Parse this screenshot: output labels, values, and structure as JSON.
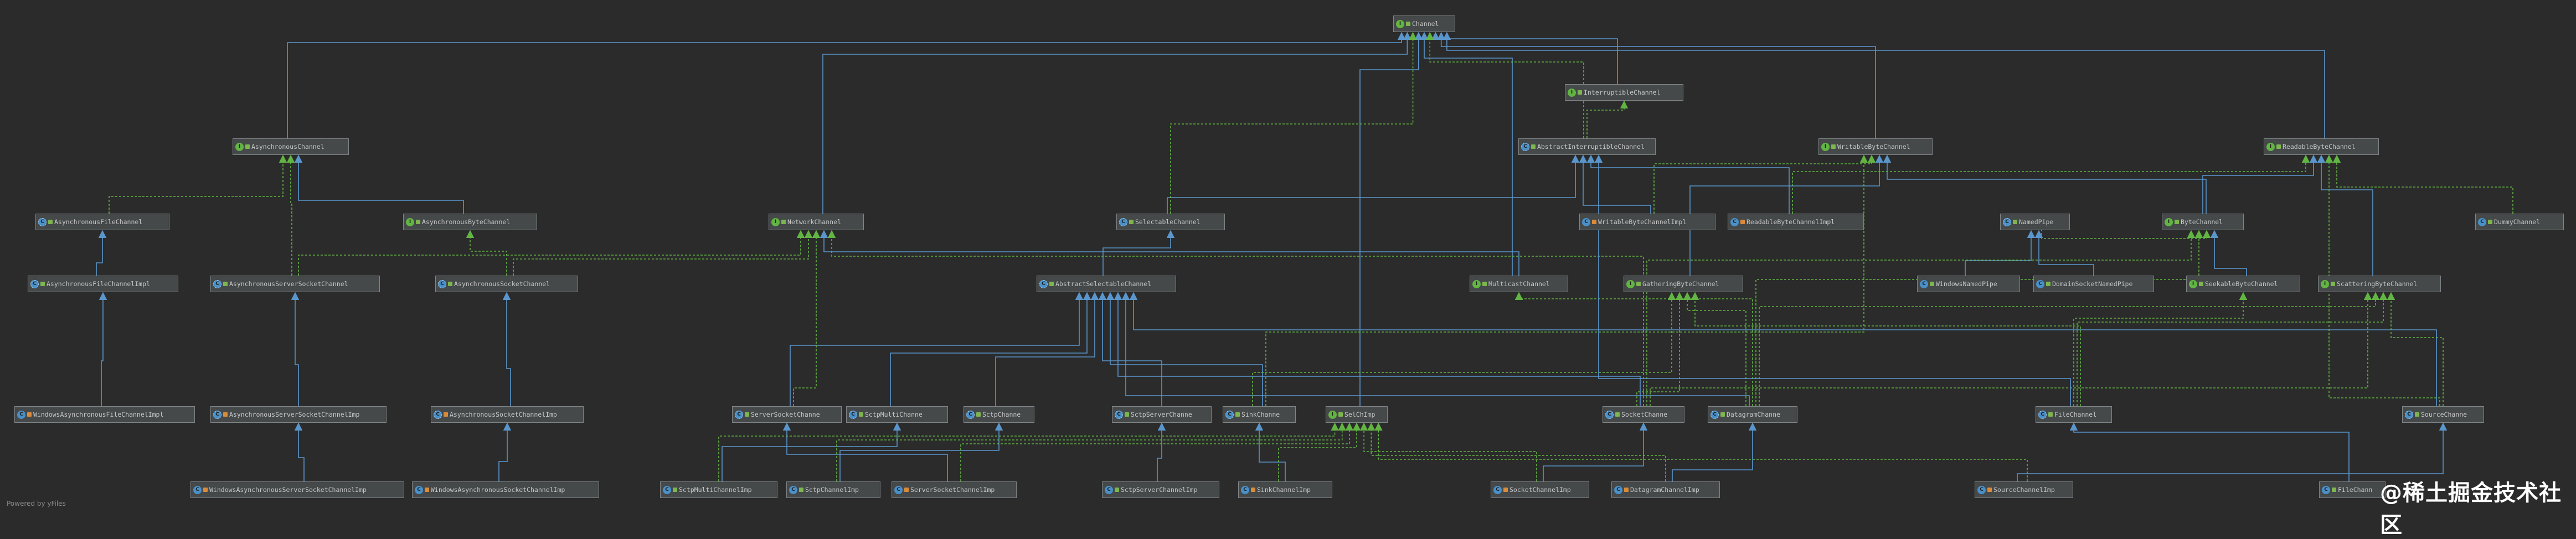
{
  "footer": "Powered by yFiles",
  "watermark": "@稀土掘金技术社区",
  "colors": {
    "background": "#2b2b2b",
    "extends_edge": "#5a96cc",
    "implements_edge": "#62b543",
    "node_fill": "#45494a",
    "node_border": "#7f8487"
  },
  "nodes": [
    {
      "id": "Channel",
      "label": "Channel",
      "kind": "interface",
      "vis": "public"
    },
    {
      "id": "InterruptibleChannel",
      "label": "InterruptibleChannel",
      "kind": "interface",
      "vis": "public"
    },
    {
      "id": "AsynchronousChannel",
      "label": "AsynchronousChannel",
      "kind": "interface",
      "vis": "public"
    },
    {
      "id": "AbstractInterruptibleChannel",
      "label": "AbstractInterruptibleChannel",
      "kind": "abstract",
      "vis": "public"
    },
    {
      "id": "WritableByteChannel",
      "label": "WritableByteChannel",
      "kind": "interface",
      "vis": "public"
    },
    {
      "id": "ReadableByteChannel",
      "label": "ReadableByteChannel",
      "kind": "interface",
      "vis": "public"
    },
    {
      "id": "AsynchronousFileChannel",
      "label": "AsynchronousFileChannel",
      "kind": "abstract",
      "vis": "public"
    },
    {
      "id": "AsynchronousByteChannel",
      "label": "AsynchronousByteChannel",
      "kind": "interface",
      "vis": "public"
    },
    {
      "id": "NetworkChannel",
      "label": "NetworkChannel",
      "kind": "interface",
      "vis": "public"
    },
    {
      "id": "SelectableChannel",
      "label": "SelectableChannel",
      "kind": "abstract",
      "vis": "public"
    },
    {
      "id": "WritableByteChannelImpl",
      "label": "WritableByteChannelImpl",
      "kind": "class",
      "vis": "pkg"
    },
    {
      "id": "ReadableByteChannelImpl",
      "label": "ReadableByteChannelImpl",
      "kind": "class",
      "vis": "pkg"
    },
    {
      "id": "NamedPipe",
      "label": "NamedPipe",
      "kind": "abstract",
      "vis": "public"
    },
    {
      "id": "ByteChannel",
      "label": "ByteChannel",
      "kind": "interface",
      "vis": "public"
    },
    {
      "id": "DummyChannel",
      "label": "DummyChannel",
      "kind": "class",
      "vis": "public"
    },
    {
      "id": "AsynchronousFileChannelImpl",
      "label": "AsynchronousFileChannelImpl",
      "kind": "abstract",
      "vis": "public"
    },
    {
      "id": "AsynchronousServerSocketChannel",
      "label": "AsynchronousServerSocketChannel",
      "kind": "abstract",
      "vis": "public"
    },
    {
      "id": "AsynchronousSocketChannel",
      "label": "AsynchronousSocketChannel",
      "kind": "abstract",
      "vis": "public"
    },
    {
      "id": "AbstractSelectableChannel",
      "label": "AbstractSelectableChannel",
      "kind": "abstract",
      "vis": "public"
    },
    {
      "id": "MulticastChannel",
      "label": "MulticastChannel",
      "kind": "interface",
      "vis": "public"
    },
    {
      "id": "GatheringByteChannel",
      "label": "GatheringByteChannel",
      "kind": "interface",
      "vis": "public"
    },
    {
      "id": "WindowsNamedPipe",
      "label": "WindowsNamedPipe",
      "kind": "class",
      "vis": "public"
    },
    {
      "id": "DomainSocketNamedPipe",
      "label": "DomainSocketNamedPipe",
      "kind": "class",
      "vis": "public"
    },
    {
      "id": "SeekableByteChannel",
      "label": "SeekableByteChannel",
      "kind": "interface",
      "vis": "public"
    },
    {
      "id": "ScatteringByteChannel",
      "label": "ScatteringByteChannel",
      "kind": "interface",
      "vis": "public"
    },
    {
      "id": "WindowsAsynchronousFileChannelImpl",
      "label": "WindowsAsynchronousFileChannelImpl",
      "kind": "class",
      "vis": "pkg"
    },
    {
      "id": "AsynchronousServerSocketChannelImp",
      "label": "AsynchronousServerSocketChannelImp",
      "kind": "abstract",
      "vis": "pkg"
    },
    {
      "id": "AsynchronousSocketChannelImp",
      "label": "AsynchronousSocketChannelImp",
      "kind": "abstract",
      "vis": "pkg"
    },
    {
      "id": "ServerSocketChannel",
      "label": "ServerSocketChanne",
      "kind": "abstract",
      "vis": "public"
    },
    {
      "id": "SctpMultiChannel",
      "label": "SctpMultiChanne",
      "kind": "abstract",
      "vis": "public"
    },
    {
      "id": "SctpChannel",
      "label": "SctpChanne",
      "kind": "abstract",
      "vis": "public"
    },
    {
      "id": "SctpServerChannel",
      "label": "SctpServerChanne",
      "kind": "abstract",
      "vis": "public"
    },
    {
      "id": "SinkChannel",
      "label": "SinkChanne",
      "kind": "abstract",
      "vis": "public"
    },
    {
      "id": "SelChImpl",
      "label": "SelChImp",
      "kind": "interface",
      "vis": "public"
    },
    {
      "id": "SocketChannel",
      "label": "SocketChanne",
      "kind": "abstract",
      "vis": "public"
    },
    {
      "id": "DatagramChannel",
      "label": "DatagramChanne",
      "kind": "abstract",
      "vis": "public"
    },
    {
      "id": "FileChannel",
      "label": "FileChannel",
      "kind": "abstract",
      "vis": "public"
    },
    {
      "id": "SourceChannel",
      "label": "SourceChanne",
      "kind": "abstract",
      "vis": "public"
    },
    {
      "id": "WindowsAsynchronousServerSocketChannelImpl",
      "label": "WindowsAsynchronousServerSocketChannelImp",
      "kind": "class",
      "vis": "pkg"
    },
    {
      "id": "WindowsAsynchronousSocketChannelImpl",
      "label": "WindowsAsynchronousSocketChannelImp",
      "kind": "class",
      "vis": "pkg"
    },
    {
      "id": "SctpMultiChannelImpl",
      "label": "SctpMultiChannelImp",
      "kind": "class",
      "vis": "public"
    },
    {
      "id": "SctpChannelImpl",
      "label": "SctpChannelImp",
      "kind": "class",
      "vis": "public"
    },
    {
      "id": "ServerSocketChannelImpl",
      "label": "ServerSocketChannelImp",
      "kind": "class",
      "vis": "pkg"
    },
    {
      "id": "SctpServerChannelImpl",
      "label": "SctpServerChannelImp",
      "kind": "class",
      "vis": "public"
    },
    {
      "id": "SinkChannelImpl",
      "label": "SinkChannelImp",
      "kind": "class",
      "vis": "pkg"
    },
    {
      "id": "SocketChannelImpl",
      "label": "SocketChannelImp",
      "kind": "class",
      "vis": "pkg"
    },
    {
      "id": "DatagramChannelImpl",
      "label": "DatagramChannelImp",
      "kind": "class",
      "vis": "pkg"
    },
    {
      "id": "SourceChannelImpl",
      "label": "SourceChannelImp",
      "kind": "class",
      "vis": "pkg"
    },
    {
      "id": "FileChannelImpl",
      "label": "FileChann",
      "kind": "class",
      "vis": "public"
    }
  ],
  "edges": [
    {
      "from": "InterruptibleChannel",
      "to": "Channel",
      "type": "extends"
    },
    {
      "from": "AsynchronousChannel",
      "to": "Channel",
      "type": "extends"
    },
    {
      "from": "WritableByteChannel",
      "to": "Channel",
      "type": "extends"
    },
    {
      "from": "ReadableByteChannel",
      "to": "Channel",
      "type": "extends"
    },
    {
      "from": "NetworkChannel",
      "to": "Channel",
      "type": "extends"
    },
    {
      "from": "MulticastChannel",
      "to": "Channel",
      "type": "extends"
    },
    {
      "from": "AbstractInterruptibleChannel",
      "to": "Channel",
      "type": "implements"
    },
    {
      "from": "AbstractInterruptibleChannel",
      "to": "InterruptibleChannel",
      "type": "implements"
    },
    {
      "from": "SelChImpl",
      "to": "Channel",
      "type": "extends"
    },
    {
      "from": "AsynchronousFileChannel",
      "to": "AsynchronousChannel",
      "type": "implements"
    },
    {
      "from": "AsynchronousByteChannel",
      "to": "AsynchronousChannel",
      "type": "extends"
    },
    {
      "from": "AsynchronousServerSocketChannel",
      "to": "AsynchronousChannel",
      "type": "implements"
    },
    {
      "from": "AsynchronousSocketChannel",
      "to": "AsynchronousByteChannel",
      "type": "implements"
    },
    {
      "from": "AsynchronousServerSocketChannel",
      "to": "NetworkChannel",
      "type": "implements"
    },
    {
      "from": "AsynchronousSocketChannel",
      "to": "NetworkChannel",
      "type": "implements"
    },
    {
      "from": "AsynchronousFileChannelImpl",
      "to": "AsynchronousFileChannel",
      "type": "extends"
    },
    {
      "from": "WindowsAsynchronousFileChannelImpl",
      "to": "AsynchronousFileChannelImpl",
      "type": "extends"
    },
    {
      "from": "AsynchronousServerSocketChannelImp",
      "to": "AsynchronousServerSocketChannel",
      "type": "extends"
    },
    {
      "from": "AsynchronousSocketChannelImp",
      "to": "AsynchronousSocketChannel",
      "type": "extends"
    },
    {
      "from": "WindowsAsynchronousServerSocketChannelImpl",
      "to": "AsynchronousServerSocketChannelImp",
      "type": "extends"
    },
    {
      "from": "WindowsAsynchronousSocketChannelImpl",
      "to": "AsynchronousSocketChannelImp",
      "type": "extends"
    },
    {
      "from": "SelectableChannel",
      "to": "AbstractInterruptibleChannel",
      "type": "extends"
    },
    {
      "from": "SelectableChannel",
      "to": "Channel",
      "type": "implements"
    },
    {
      "from": "WritableByteChannelImpl",
      "to": "AbstractInterruptibleChannel",
      "type": "extends"
    },
    {
      "from": "WritableByteChannelImpl",
      "to": "WritableByteChannel",
      "type": "implements"
    },
    {
      "from": "ReadableByteChannelImpl",
      "to": "AbstractInterruptibleChannel",
      "type": "extends"
    },
    {
      "from": "ReadableByteChannelImpl",
      "to": "ReadableByteChannel",
      "type": "implements"
    },
    {
      "from": "ByteChannel",
      "to": "ReadableByteChannel",
      "type": "extends"
    },
    {
      "from": "ByteChannel",
      "to": "WritableByteChannel",
      "type": "extends"
    },
    {
      "from": "NamedPipe",
      "to": "ByteChannel",
      "type": "implements"
    },
    {
      "from": "DummyChannel",
      "to": "ReadableByteChannel",
      "type": "implements"
    },
    {
      "from": "WindowsNamedPipe",
      "to": "NamedPipe",
      "type": "extends"
    },
    {
      "from": "DomainSocketNamedPipe",
      "to": "NamedPipe",
      "type": "extends"
    },
    {
      "from": "SeekableByteChannel",
      "to": "ByteChannel",
      "type": "extends"
    },
    {
      "from": "GatheringByteChannel",
      "to": "WritableByteChannel",
      "type": "extends"
    },
    {
      "from": "ScatteringByteChannel",
      "to": "ReadableByteChannel",
      "type": "extends"
    },
    {
      "from": "AbstractSelectableChannel",
      "to": "SelectableChannel",
      "type": "extends"
    },
    {
      "from": "MulticastChannel",
      "to": "NetworkChannel",
      "type": "extends"
    },
    {
      "from": "ServerSocketChannel",
      "to": "AbstractSelectableChannel",
      "type": "extends"
    },
    {
      "from": "ServerSocketChannel",
      "to": "NetworkChannel",
      "type": "implements"
    },
    {
      "from": "SctpMultiChannel",
      "to": "AbstractSelectableChannel",
      "type": "extends"
    },
    {
      "from": "SctpChannel",
      "to": "AbstractSelectableChannel",
      "type": "extends"
    },
    {
      "from": "SctpServerChannel",
      "to": "AbstractSelectableChannel",
      "type": "extends"
    },
    {
      "from": "SinkChannel",
      "to": "AbstractSelectableChannel",
      "type": "extends"
    },
    {
      "from": "SinkChannel",
      "to": "WritableByteChannel",
      "type": "implements"
    },
    {
      "from": "SinkChannel",
      "to": "GatheringByteChannel",
      "type": "implements"
    },
    {
      "from": "SocketChannel",
      "to": "AbstractSelectableChannel",
      "type": "extends"
    },
    {
      "from": "SocketChannel",
      "to": "NetworkChannel",
      "type": "implements"
    },
    {
      "from": "SocketChannel",
      "to": "ByteChannel",
      "type": "implements"
    },
    {
      "from": "SocketChannel",
      "to": "ScatteringByteChannel",
      "type": "implements"
    },
    {
      "from": "SocketChannel",
      "to": "GatheringByteChannel",
      "type": "implements"
    },
    {
      "from": "DatagramChannel",
      "to": "AbstractSelectableChannel",
      "type": "extends"
    },
    {
      "from": "DatagramChannel",
      "to": "MulticastChannel",
      "type": "implements"
    },
    {
      "from": "DatagramChannel",
      "to": "ByteChannel",
      "type": "implements"
    },
    {
      "from": "DatagramChannel",
      "to": "ScatteringByteChannel",
      "type": "implements"
    },
    {
      "from": "DatagramChannel",
      "to": "GatheringByteChannel",
      "type": "implements"
    },
    {
      "from": "FileChannel",
      "to": "AbstractInterruptibleChannel",
      "type": "extends"
    },
    {
      "from": "FileChannel",
      "to": "SeekableByteChannel",
      "type": "implements"
    },
    {
      "from": "FileChannel",
      "to": "ScatteringByteChannel",
      "type": "implements"
    },
    {
      "from": "FileChannel",
      "to": "GatheringByteChannel",
      "type": "implements"
    },
    {
      "from": "SourceChannel",
      "to": "AbstractSelectableChannel",
      "type": "extends"
    },
    {
      "from": "SourceChannel",
      "to": "ReadableByteChannel",
      "type": "implements"
    },
    {
      "from": "SourceChannel",
      "to": "ScatteringByteChannel",
      "type": "implements"
    },
    {
      "from": "SctpMultiChannelImpl",
      "to": "SctpMultiChannel",
      "type": "extends"
    },
    {
      "from": "SctpChannelImpl",
      "to": "SctpChannel",
      "type": "extends"
    },
    {
      "from": "ServerSocketChannelImpl",
      "to": "ServerSocketChannel",
      "type": "extends"
    },
    {
      "from": "SctpServerChannelImpl",
      "to": "SctpServerChannel",
      "type": "extends"
    },
    {
      "from": "SinkChannelImpl",
      "to": "SinkChannel",
      "type": "extends"
    },
    {
      "from": "SocketChannelImpl",
      "to": "SocketChannel",
      "type": "extends"
    },
    {
      "from": "DatagramChannelImpl",
      "to": "DatagramChannel",
      "type": "extends"
    },
    {
      "from": "SourceChannelImpl",
      "to": "SourceChannel",
      "type": "extends"
    },
    {
      "from": "FileChannelImpl",
      "to": "FileChannel",
      "type": "extends"
    },
    {
      "from": "SctpMultiChannelImpl",
      "to": "SelChImpl",
      "type": "implements"
    },
    {
      "from": "SctpChannelImpl",
      "to": "SelChImpl",
      "type": "implements"
    },
    {
      "from": "ServerSocketChannelImpl",
      "to": "SelChImpl",
      "type": "implements"
    },
    {
      "from": "SinkChannelImpl",
      "to": "SelChImpl",
      "type": "implements"
    },
    {
      "from": "SocketChannelImpl",
      "to": "SelChImpl",
      "type": "implements"
    },
    {
      "from": "DatagramChannelImpl",
      "to": "SelChImpl",
      "type": "implements"
    },
    {
      "from": "SourceChannelImpl",
      "to": "SelChImpl",
      "type": "implements"
    }
  ]
}
